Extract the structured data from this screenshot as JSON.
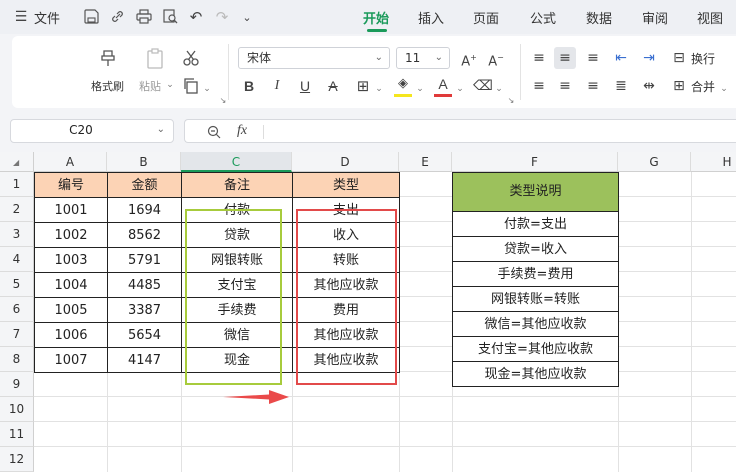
{
  "menubar": {
    "menu_icon": "hamburger-icon",
    "file_label": "文件",
    "tabs": [
      {
        "label": "开始",
        "active": true
      },
      {
        "label": "插入"
      },
      {
        "label": "页面"
      },
      {
        "label": "公式"
      },
      {
        "label": "数据"
      },
      {
        "label": "审阅"
      },
      {
        "label": "视图"
      }
    ]
  },
  "ribbon": {
    "format_painter": "格式刷",
    "paste": "粘贴",
    "font_name": "宋体",
    "font_size": "11",
    "wrap_text": "换行",
    "merge": "合并",
    "colors": {
      "highlight": "#f5e61e",
      "font": "#e03a3a"
    }
  },
  "formula_bar": {
    "cell_ref": "C20",
    "fx_label": "fx",
    "formula": ""
  },
  "grid": {
    "columns": [
      "A",
      "B",
      "C",
      "D",
      "E",
      "F",
      "G",
      "H"
    ],
    "selected_column": "C",
    "rows": [
      "1",
      "2",
      "3",
      "4",
      "5",
      "6",
      "7",
      "8",
      "9",
      "10",
      "11",
      "12"
    ],
    "table": {
      "headers": [
        "编号",
        "金额",
        "备注",
        "类型"
      ],
      "rows": [
        [
          "1001",
          "1694",
          "付款",
          "支出"
        ],
        [
          "1002",
          "8562",
          "贷款",
          "收入"
        ],
        [
          "1003",
          "5791",
          "网银转账",
          "转账"
        ],
        [
          "1004",
          "4485",
          "支付宝",
          "其他应收款"
        ],
        [
          "1005",
          "3387",
          "手续费",
          "费用"
        ],
        [
          "1006",
          "5654",
          "微信",
          "其他应收款"
        ],
        [
          "1007",
          "4147",
          "现金",
          "其他应收款"
        ]
      ]
    },
    "legend": {
      "header": "类型说明",
      "items": [
        "付款=支出",
        "贷款=收入",
        "手续费=费用",
        "网银转账=转账",
        "微信=其他应收款",
        "支付宝=其他应收款",
        "现金=其他应收款"
      ]
    },
    "colors": {
      "header_fill": "#fcd3b5",
      "legend_header_fill": "#9cc15c",
      "green_box": "#a7cb3c",
      "red_box": "#e24a4a"
    }
  }
}
